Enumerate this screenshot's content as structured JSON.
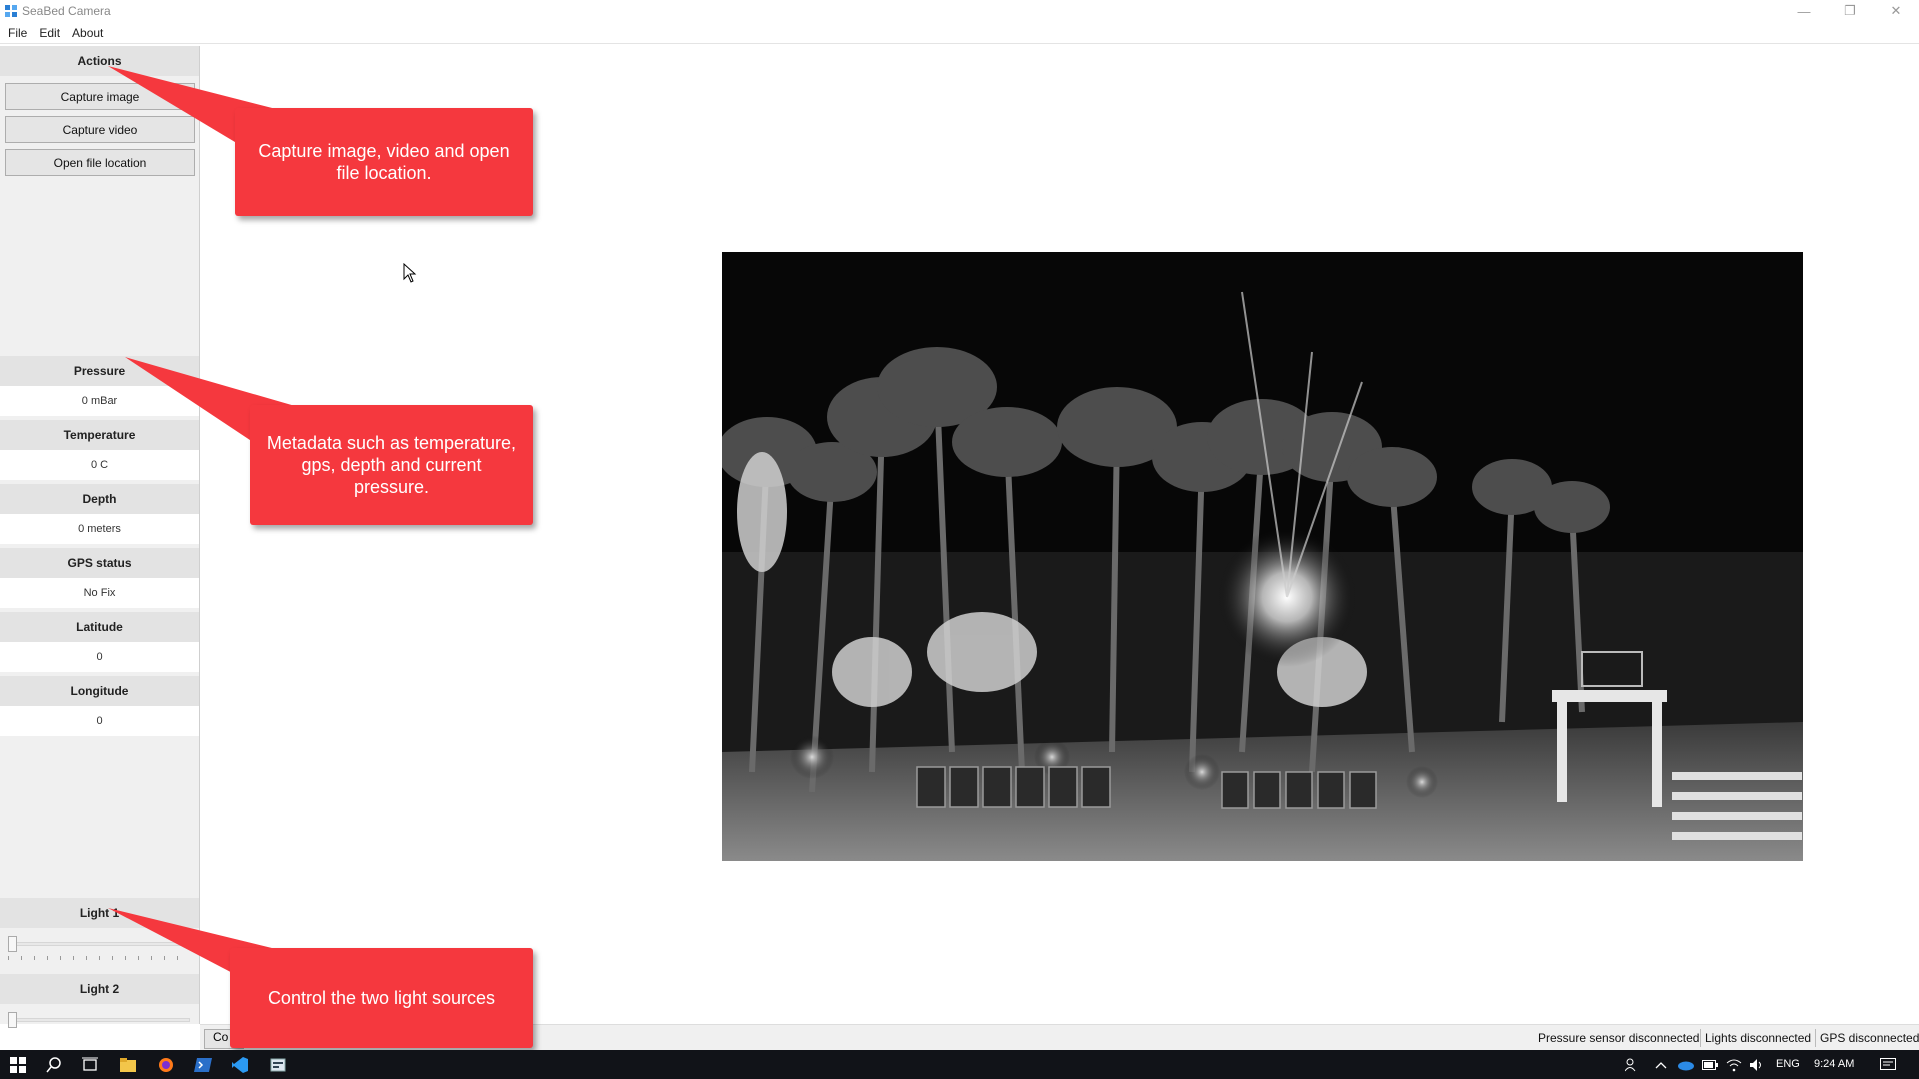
{
  "window": {
    "title": "SeaBed Camera",
    "minimize_glyph": "—",
    "restore_glyph": "❐",
    "close_glyph": "✕"
  },
  "menu": {
    "items": [
      "File",
      "Edit",
      "About"
    ]
  },
  "sidebar": {
    "actions_header": "Actions",
    "buttons": [
      "Capture image",
      "Capture video",
      "Open file location"
    ],
    "metadata": [
      {
        "label": "Pressure",
        "value": "0 mBar"
      },
      {
        "label": "Temperature",
        "value": "0 C"
      },
      {
        "label": "Depth",
        "value": "0 meters"
      },
      {
        "label": "GPS status",
        "value": "No Fix"
      },
      {
        "label": "Latitude",
        "value": "0"
      },
      {
        "label": "Longitude",
        "value": "0"
      }
    ],
    "lights": [
      {
        "label": "Light 1",
        "level": 0
      },
      {
        "label": "Light 2",
        "level": 0
      }
    ]
  },
  "status": {
    "stub_button": "Co",
    "items": [
      "Pressure sensor disconnected",
      "Lights disconnected",
      "GPS disconnected"
    ]
  },
  "callouts": [
    "Capture image, video and open file location.",
    "Metadata such as temperature, gps, depth and current pressure.",
    "Control the two light sources"
  ],
  "taskbar": {
    "language": "ENG",
    "time": "9:24 AM",
    "icons": [
      "windows-start-icon",
      "search-icon",
      "task-view-icon",
      "file-explorer-icon",
      "firefox-icon",
      "powershell-icon",
      "vscode-icon",
      "app-icon"
    ]
  },
  "colors": {
    "callout": "#f5383e",
    "sidebar_bg": "#f0f0f0",
    "header_bg": "#e3e3e3",
    "taskbar_bg": "#111318"
  }
}
